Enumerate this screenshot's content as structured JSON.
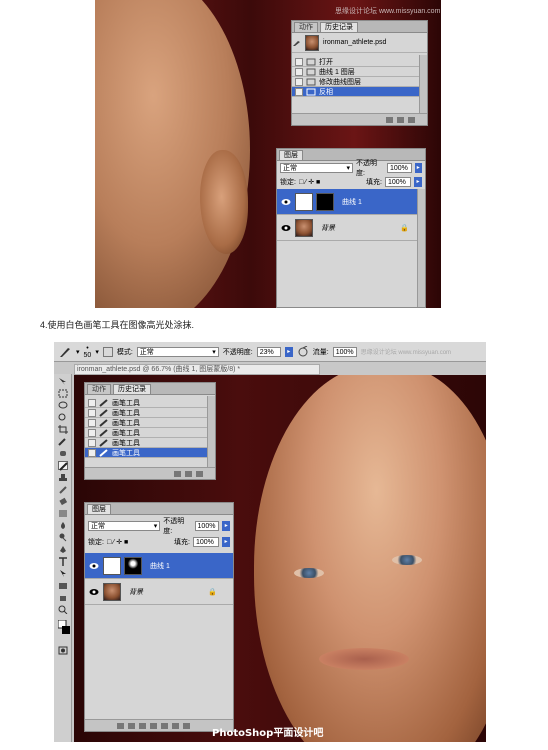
{
  "top": {
    "watermark": "思缘设计论坛 www.missyuan.com",
    "history_panel": {
      "tabs": [
        "动作",
        "历史记录"
      ],
      "snapshot": "ironman_athlete.psd",
      "items": [
        "打开",
        "曲线 1 图层",
        "修改曲线图层",
        "反相"
      ],
      "selected_index": 3
    },
    "layers_panel": {
      "tab": "图层",
      "blend_mode": "正常",
      "opacity_label": "不透明度:",
      "opacity": "100%",
      "lock_label": "锁定:",
      "fill_label": "填充:",
      "fill": "100%",
      "layers": [
        {
          "name": "曲线 1",
          "selected": true
        },
        {
          "name": "背景",
          "selected": false
        }
      ]
    }
  },
  "caption": "4.使用白色画笔工具在图像高光处涂抹.",
  "bottom": {
    "options": {
      "brush_size": "50",
      "mode_label": "模式:",
      "mode": "正常",
      "opacity_label": "不透明度:",
      "opacity": "23%",
      "flow_label": "流量:",
      "flow": "100%",
      "watermark": "思缘设计论坛 www.missyuan.com"
    },
    "doc_title": "ironman_athlete.psd @ 66.7% (曲线 1, 图层蒙版/8) *",
    "history_panel": {
      "tabs": [
        "动作",
        "历史记录"
      ],
      "items": [
        "画笔工具",
        "画笔工具",
        "画笔工具",
        "画笔工具",
        "画笔工具",
        "画笔工具"
      ],
      "selected_index": 5
    },
    "layers_panel": {
      "tab": "图层",
      "blend_mode": "正常",
      "opacity_label": "不透明度:",
      "opacity": "100%",
      "lock_label": "锁定:",
      "fill_label": "填充:",
      "fill": "100%",
      "layers": [
        {
          "name": "曲线 1",
          "selected": true
        },
        {
          "name": "背景",
          "selected": false
        }
      ]
    },
    "bottom_watermark": "PhotoShop平面设计吧 【www.linecg.com/tieba/1780】"
  },
  "colors": {
    "selection": "#3a66c8",
    "panel_bg": "#d6d6d6"
  }
}
